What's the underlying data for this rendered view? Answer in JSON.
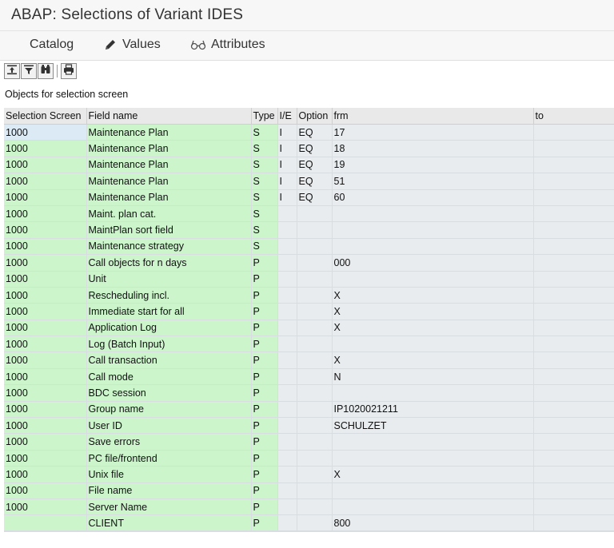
{
  "window": {
    "title": "ABAP: Selections of Variant IDES"
  },
  "menu": {
    "catalog": "Catalog",
    "values": "Values",
    "attributes": "Attributes"
  },
  "toolbar": {
    "icons": [
      "align-top-icon",
      "filter-icon",
      "binoculars-icon",
      "print-icon"
    ]
  },
  "section": {
    "label": "Objects for selection screen"
  },
  "table": {
    "headers": [
      "Selection Screen",
      "Field name",
      "Type",
      "I/E",
      "Option",
      "frm",
      "to"
    ],
    "rows": [
      [
        "1000",
        "Maintenance Plan",
        "S",
        "I",
        "EQ",
        "17",
        ""
      ],
      [
        "1000",
        "Maintenance Plan",
        "S",
        "I",
        "EQ",
        "18",
        ""
      ],
      [
        "1000",
        "Maintenance Plan",
        "S",
        "I",
        "EQ",
        "19",
        ""
      ],
      [
        "1000",
        "Maintenance Plan",
        "S",
        "I",
        "EQ",
        "51",
        ""
      ],
      [
        "1000",
        "Maintenance Plan",
        "S",
        "I",
        "EQ",
        "60",
        ""
      ],
      [
        "1000",
        "Maint. plan cat.",
        "S",
        "",
        "",
        "",
        ""
      ],
      [
        "1000",
        "MaintPlan sort field",
        "S",
        "",
        "",
        "",
        ""
      ],
      [
        "1000",
        "Maintenance strategy",
        "S",
        "",
        "",
        "",
        ""
      ],
      [
        "1000",
        "Call objects for n days",
        "P",
        "",
        "",
        "000",
        ""
      ],
      [
        "1000",
        "Unit",
        "P",
        "",
        "",
        "",
        ""
      ],
      [
        "1000",
        "Rescheduling incl.",
        "P",
        "",
        "",
        "X",
        ""
      ],
      [
        "1000",
        "Immediate start for all",
        "P",
        "",
        "",
        "X",
        ""
      ],
      [
        "1000",
        "Application Log",
        "P",
        "",
        "",
        "X",
        ""
      ],
      [
        "1000",
        "Log (Batch Input)",
        "P",
        "",
        "",
        "",
        ""
      ],
      [
        "1000",
        "Call transaction",
        "P",
        "",
        "",
        "X",
        ""
      ],
      [
        "1000",
        "Call mode",
        "P",
        "",
        "",
        "N",
        ""
      ],
      [
        "1000",
        "BDC session",
        "P",
        "",
        "",
        "",
        ""
      ],
      [
        "1000",
        "Group name",
        "P",
        "",
        "",
        "IP1020021211",
        ""
      ],
      [
        "1000",
        "User ID",
        "P",
        "",
        "",
        "SCHULZET",
        ""
      ],
      [
        "1000",
        "Save errors",
        "P",
        "",
        "",
        "",
        ""
      ],
      [
        "1000",
        "PC file/frontend",
        "P",
        "",
        "",
        "",
        ""
      ],
      [
        "1000",
        "Unix file",
        "P",
        "",
        "",
        "X",
        ""
      ],
      [
        "1000",
        "File name",
        "P",
        "",
        "",
        "",
        ""
      ],
      [
        "1000",
        "Server Name",
        "P",
        "",
        "",
        "",
        ""
      ],
      [
        "",
        "CLIENT",
        "P",
        "",
        "",
        "800",
        ""
      ]
    ]
  },
  "colors": {
    "key_column": "#ccf5cc",
    "value_column": "#e8ecee",
    "selected_cell": "#dceaf6",
    "header": "#e9e9e9"
  }
}
